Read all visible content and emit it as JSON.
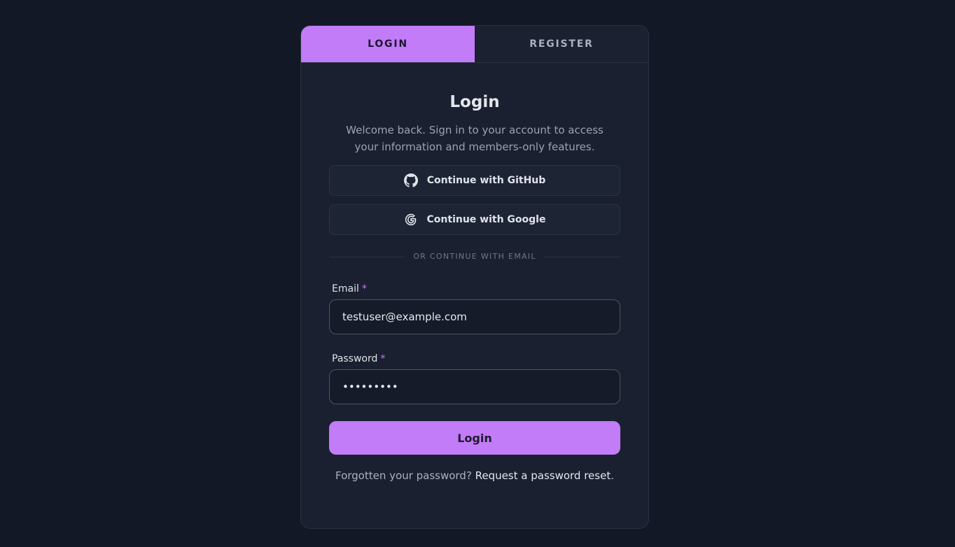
{
  "tabs": {
    "login": "LOGIN",
    "register": "REGISTER",
    "active": "login"
  },
  "form": {
    "title": "Login",
    "subtitle": "Welcome back. Sign in to your account to access your information and members-only features.",
    "github_label": "Continue with GitHub",
    "google_label": "Continue with Google",
    "divider_text": "OR CONTINUE WITH EMAIL",
    "email_label": "Email",
    "email_value": "testuser@example.com",
    "password_label": "Password",
    "password_value": "•••••••••",
    "required_mark": "*",
    "submit_label": "Login",
    "forgot_text": "Forgotten your password?",
    "reset_link": "Request a password reset",
    "reset_suffix": "."
  },
  "icons": {
    "github": "github-icon",
    "google": "google-icon"
  },
  "colors": {
    "accent": "#c27cf7",
    "background": "#121826",
    "card": "#1a2030"
  }
}
